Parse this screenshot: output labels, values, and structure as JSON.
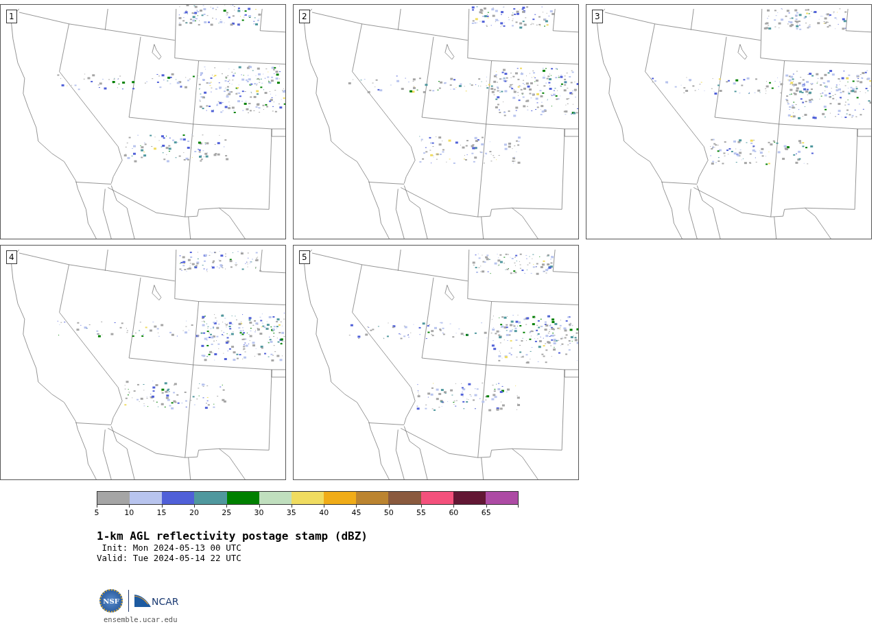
{
  "panels": [
    {
      "label": "1"
    },
    {
      "label": "2"
    },
    {
      "label": "3"
    },
    {
      "label": "4"
    },
    {
      "label": "5"
    }
  ],
  "colorbar": {
    "bins": [
      {
        "color": "#a5a5a5"
      },
      {
        "color": "#b8c4ee"
      },
      {
        "color": "#5060d8"
      },
      {
        "color": "#50989e"
      },
      {
        "color": "#008000"
      },
      {
        "color": "#c0dfbe"
      },
      {
        "color": "#f0dc60"
      },
      {
        "color": "#f0ac18"
      },
      {
        "color": "#bb8430"
      },
      {
        "color": "#8a5a3e"
      },
      {
        "color": "#f4517c"
      },
      {
        "color": "#621734"
      },
      {
        "color": "#ad4ba4"
      }
    ],
    "ticks": [
      "5",
      "10",
      "15",
      "20",
      "25",
      "30",
      "35",
      "40",
      "45",
      "50",
      "55",
      "60",
      "65"
    ]
  },
  "title": "1-km AGL reflectivity postage stamp (dBZ)",
  "init": " Init: Mon 2024-05-13 00 UTC",
  "valid": "Valid: Tue 2024-05-14 22 UTC",
  "logo": {
    "left": "NSF",
    "right": "NCAR"
  },
  "footer": "ensemble.ucar.edu"
}
